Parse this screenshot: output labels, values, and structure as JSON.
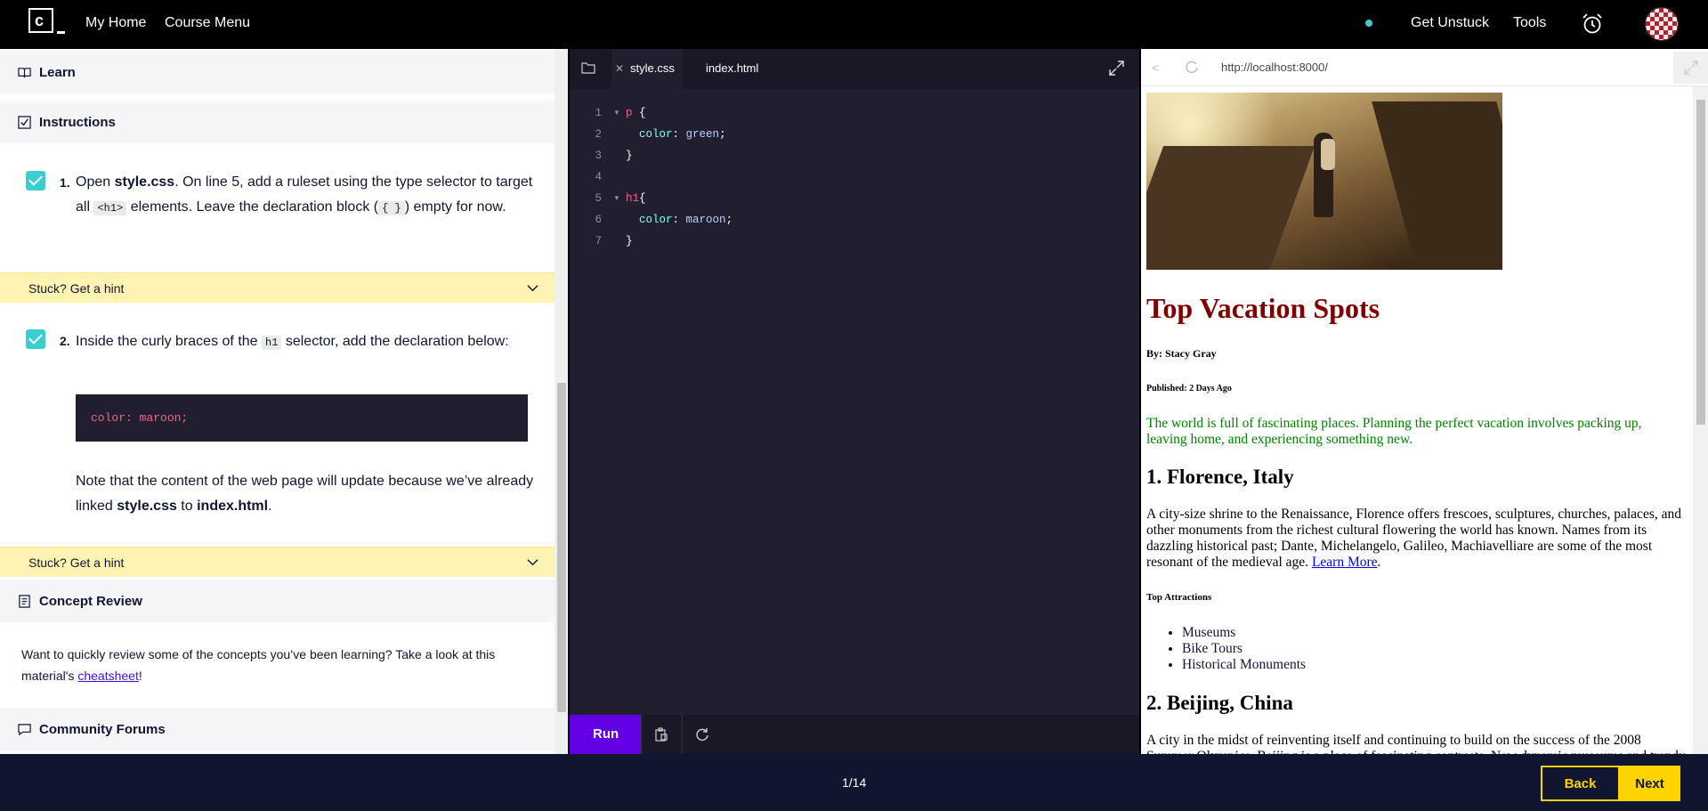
{
  "nav": {
    "logo": "c",
    "my_home": "My Home",
    "course_menu": "Course Menu",
    "get_unstuck": "Get Unstuck",
    "tools": "Tools"
  },
  "left": {
    "learn": "Learn",
    "instructions": "Instructions",
    "steps": [
      {
        "number": "1.",
        "text_a": "Open ",
        "file": "style.css",
        "text_b": ". On line 5, add a ruleset using the type selector to target all ",
        "code": "<h1>",
        "text_c": " elements. Leave the declaration block (",
        "code2": "{ }",
        "text_d": ") empty for now."
      },
      {
        "number": "2.",
        "text_a": "Inside the curly braces of the ",
        "code": "h1",
        "text_b": " selector, add the declaration below:",
        "code_block": "color: maroon;",
        "note_a": "Note that the content of the web page will update because we’ve already linked ",
        "note_file1": "style.css",
        "note_b": " to ",
        "note_file2": "index.html",
        "note_c": "."
      }
    ],
    "hint": "Stuck? Get a hint",
    "concept_review": "Concept Review",
    "concept_text_a": "Want to quickly review some of the concepts you’ve been learning? Take a look at this material's ",
    "concept_link": "cheatsheet",
    "concept_text_b": "!",
    "community": "Community Forums"
  },
  "editor": {
    "tabs": [
      "style.css",
      "index.html"
    ],
    "lines": [
      {
        "n": "1",
        "sel": "p",
        "rest": " {"
      },
      {
        "n": "2",
        "prop": "color",
        "val": "green"
      },
      {
        "n": "3",
        "plain": "}"
      },
      {
        "n": "4",
        "plain": ""
      },
      {
        "n": "5",
        "sel": "h1",
        "rest": "{"
      },
      {
        "n": "6",
        "prop": "color",
        "val": "maroon"
      },
      {
        "n": "7",
        "plain": "}"
      }
    ],
    "run": "Run"
  },
  "browser": {
    "url": "http://localhost:8000/",
    "title": "Top Vacation Spots",
    "byline": "By: Stacy Gray",
    "published": "Published: 2 Days Ago",
    "intro": "The world is full of fascinating places. Planning the perfect vacation involves packing up, leaving home, and experiencing something new.",
    "h2_1": "1. Florence, Italy",
    "p1": "A city-size shrine to the Renaissance, Florence offers frescoes, sculptures, churches, palaces, and other monuments from the richest cultural flowering the world has known. Names from its dazzling historical past; Dante, Michelangelo, Galileo, Machiavelliare are some of the most resonant of the medieval age. ",
    "learn_more": "Learn More",
    "p1_end": ".",
    "top_attractions": "Top Attractions",
    "attractions": [
      "Museums",
      "Bike Tours",
      "Historical Monuments"
    ],
    "h2_2": "2. Beijing, China",
    "p2": "A city in the midst of reinventing itself and continuing to build on the success of the 2008 Summer Olympics, Beijing is a place of fascinating contrasts. New dynamic museums and trendy"
  },
  "footer": {
    "progress": "1/14",
    "back": "Back",
    "next": "Next"
  },
  "colors": {
    "accent": "#6400e4",
    "check": "#3ccdcf",
    "hint_bg": "#fff3b4",
    "button_yellow": "#ffd300",
    "heading_maroon": "#800000",
    "intro_green": "#008000"
  }
}
